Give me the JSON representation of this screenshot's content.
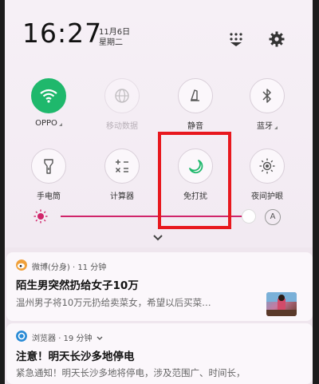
{
  "status": {
    "time": "16:27",
    "date": "11月6日",
    "weekday": "星期二"
  },
  "toggles_row1": [
    {
      "id": "wifi",
      "label": "OPPO",
      "active": true,
      "icon": "wifi-icon"
    },
    {
      "id": "mobile-data",
      "label": "移动数据",
      "active": false,
      "disabled": true,
      "icon": "globe-icon"
    },
    {
      "id": "silent",
      "label": "静音",
      "active": false,
      "icon": "bell-icon"
    },
    {
      "id": "bluetooth",
      "label": "蓝牙",
      "active": false,
      "icon": "bluetooth-icon"
    }
  ],
  "toggles_row2": [
    {
      "id": "flashlight",
      "label": "手电筒",
      "active": false,
      "icon": "flashlight-icon"
    },
    {
      "id": "calculator",
      "label": "计算器",
      "active": false,
      "icon": "calculator-icon"
    },
    {
      "id": "dnd",
      "label": "免打扰",
      "active": false,
      "icon": "moon-icon"
    },
    {
      "id": "night-mode",
      "label": "夜间护眼",
      "active": false,
      "icon": "sun-icon"
    }
  ],
  "brightness": {
    "auto_label": "A",
    "level": 0.97
  },
  "colors": {
    "accent_on": "#1fb86c",
    "slider": "#d0256a",
    "highlight": "#e8181e"
  },
  "notifications": [
    {
      "app": "微博(分身)",
      "time": "11 分钟",
      "title": "陌生男突然扔给女子10万",
      "body": "温州男子将10万元扔给卖菜女，希望以后买菜…"
    },
    {
      "app": "浏览器",
      "time": "19 分钟",
      "title": "注意！明天长沙多地停电",
      "body": "紧急通知！明天长沙多地将停电，涉及范围广、时间长，"
    }
  ]
}
